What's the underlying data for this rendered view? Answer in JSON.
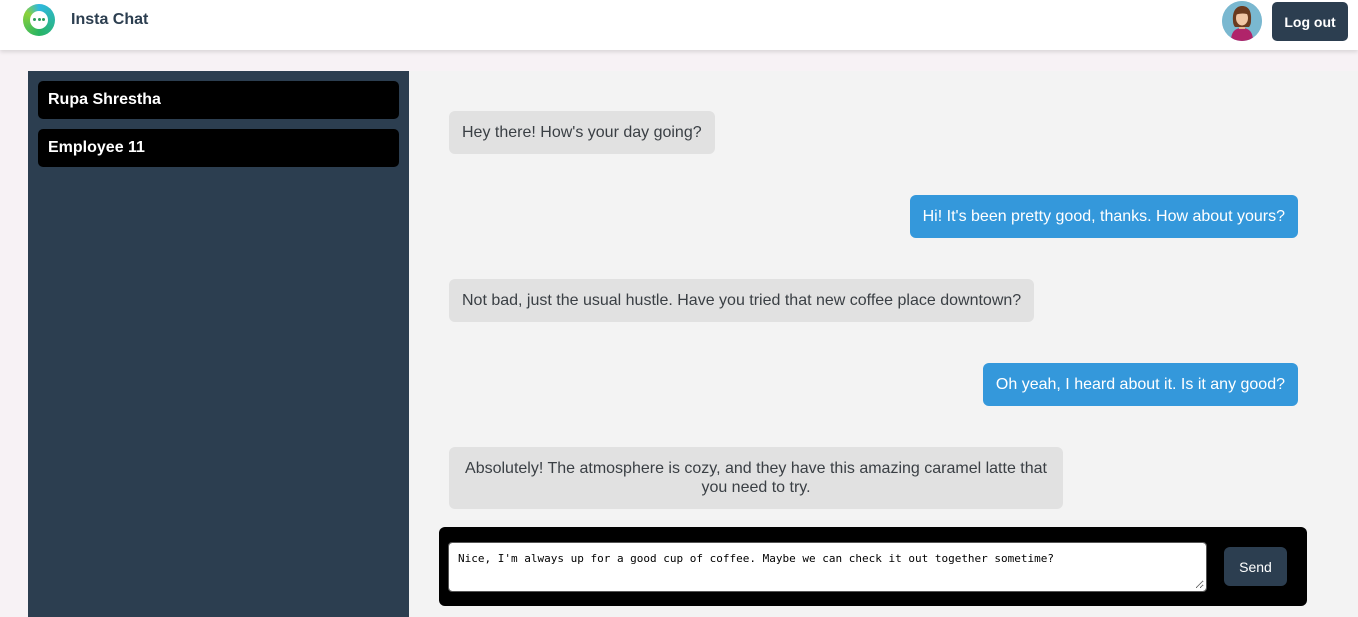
{
  "header": {
    "app_name": "Insta Chat",
    "logo_icon": "chat-bubble-logo-icon",
    "logout_label": "Log out"
  },
  "sidebar": {
    "contacts": [
      {
        "name": "Rupa Shrestha"
      },
      {
        "name": "Employee 11"
      }
    ]
  },
  "conversation": {
    "messages": [
      {
        "direction": "received",
        "text": "Hey there! How's your day going?"
      },
      {
        "direction": "sent",
        "text": "Hi! It's been pretty good, thanks. How about yours?"
      },
      {
        "direction": "received",
        "text": "Not bad, just the usual hustle. Have you tried that new coffee place downtown?"
      },
      {
        "direction": "sent",
        "text": "Oh yeah, I heard about it. Is it any good?"
      },
      {
        "direction": "received",
        "text": "Absolutely! The atmosphere is cozy, and they have this amazing caramel latte that you need to try."
      }
    ]
  },
  "composer": {
    "input_value": "Nice, I'm always up for a good cup of coffee. Maybe we can check it out together sometime?",
    "send_label": "Send"
  },
  "colors": {
    "sidebar_bg": "#2c3e50",
    "sent_bubble": "#3498db",
    "received_bubble": "#e1e1e1",
    "chat_bg": "#f3f3f3"
  }
}
